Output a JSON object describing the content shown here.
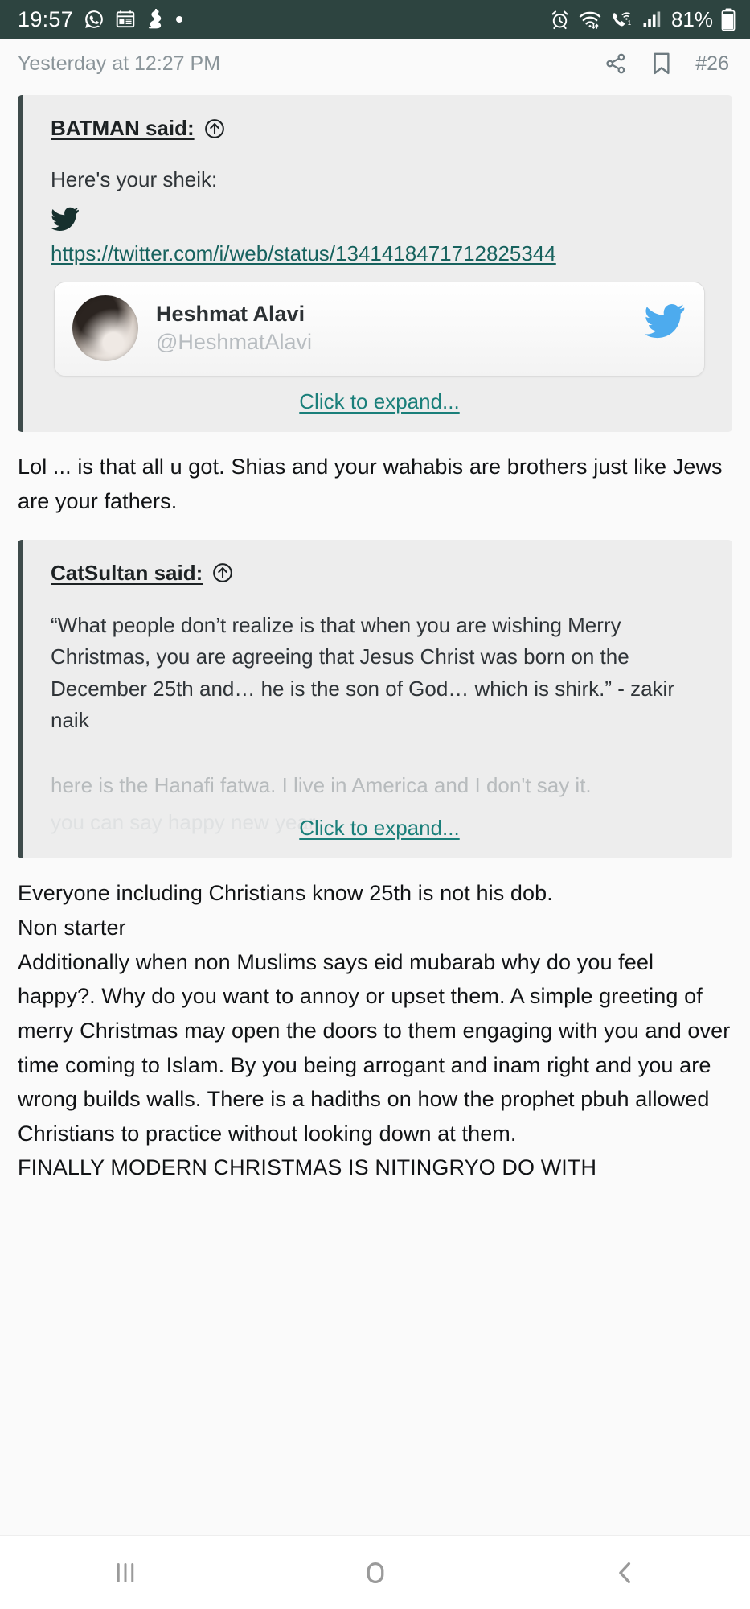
{
  "status_bar": {
    "time": "19:57",
    "battery_percent": "81%",
    "icons": [
      "whatsapp-icon",
      "calendar-icon",
      "app-icon",
      "dot-icon",
      "alarm-icon",
      "wifi-icon",
      "call-forward-icon",
      "signal-icon",
      "battery-icon"
    ],
    "background": "#2d4440"
  },
  "post_header": {
    "date": "Yesterday at 12:27 PM",
    "share_icon": "share-icon",
    "bookmark_icon": "bookmark-icon",
    "post_number": "#26"
  },
  "quote_one": {
    "author_label": "BATMAN said:",
    "jump_icon": "arrow-up-circle-icon",
    "text": "Here's your sheik:",
    "twitter_glyph": "twitter-bird-icon",
    "link": "https://twitter.com/i/web/status/1341418471712825344",
    "tweet_card": {
      "avatar": "avatar-image",
      "display_name": "Heshmat Alavi",
      "handle": "@HeshmatAlavi",
      "bird_icon": "twitter-bird-icon"
    },
    "expand_label": "Click to expand..."
  },
  "reply_one": "Lol ... is that all u got. Shias and your wahabis are brothers just like Jews are your fathers.",
  "quote_two": {
    "author_label": "CatSultan said:",
    "jump_icon": "arrow-up-circle-icon",
    "paragraph": "“What people don’t realize is that when you are wishing Merry Christmas, you are agreeing that Jesus Christ was born on the December 25th and… he is the son of God… which is shirk.” - zakir naik",
    "faded_line_1": "here is the Hanafi fatwa. I live in America and I don't say it.",
    "faded_line_2": "you can say happy new year",
    "expand_label": "Click to expand..."
  },
  "reply_two": {
    "line_1": "Everyone including Christians know 25th is not his dob.",
    "line_2": "Non starter",
    "paragraph": "Additionally when non Muslims says eid mubarab why do you feel happy?. Why do you want to annoy or upset them. A simple greeting of merry Christmas may open the doors to them engaging with you and over time coming to Islam. By you being arrogant and inam right and you are wrong builds walls. There is a hadiths on how the prophet pbuh allowed Christians to practice without looking down at them.",
    "cut_line": "FINALLY MODERN CHRISTMAS IS NITINGRYO DO WITH"
  },
  "nav_bar": {
    "recents_icon": "recents-icon",
    "home_icon": "home-icon",
    "back_icon": "back-icon"
  },
  "colors": {
    "status_bar_bg": "#2d4440",
    "quote_bg": "#ededed",
    "quote_border": "#3e4b4b",
    "link": "#17625e",
    "expand_link": "#1a7f7a",
    "twitter_blue": "#4dabee",
    "page_bg": "#fafafa"
  }
}
